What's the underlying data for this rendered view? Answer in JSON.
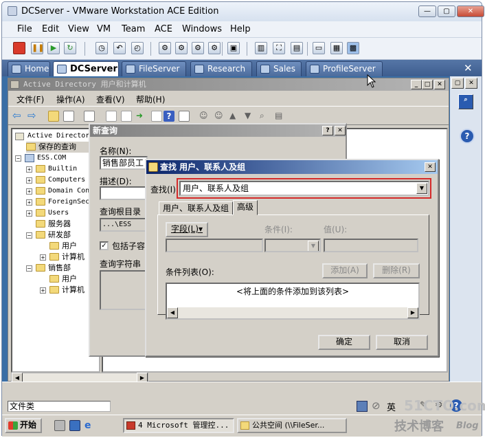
{
  "vmware": {
    "title": "DCServer - VMware Workstation ACE Edition",
    "menu": [
      "File",
      "Edit",
      "View",
      "VM",
      "Team",
      "ACE",
      "Windows",
      "Help"
    ],
    "tabs": [
      {
        "label": "Home"
      },
      {
        "label": "DCServer",
        "active": true
      },
      {
        "label": "FileServer"
      },
      {
        "label": "Research"
      },
      {
        "label": "Sales"
      },
      {
        "label": "ProfileServer"
      }
    ],
    "close_tab": "✕"
  },
  "mmc": {
    "title": "Active Directory 用户和计算机",
    "menu": [
      "文件(F)",
      "操作(A)",
      "查看(V)",
      "帮助(H)"
    ],
    "tree": {
      "root": "Active Directory",
      "saved_queries": "保存的查询",
      "domain": "ESS.COM",
      "children": [
        "Builtin",
        "Computers",
        "Domain Con",
        "ForeignSec",
        "Users"
      ],
      "ous": [
        {
          "label": "服务器"
        },
        {
          "label": "研发部",
          "children": [
            "用户",
            "计算机"
          ]
        },
        {
          "label": "销售部",
          "children": [
            "用户",
            "计算机"
          ]
        }
      ]
    }
  },
  "new_query": {
    "title": "新查询",
    "name_label": "名称(N):",
    "name_value": "销售部员工",
    "desc_label": "描述(D):",
    "root_label": "查询根目录",
    "root_value": "...\\ESS",
    "include_sub_label": "包括子容",
    "include_sub_checked": true,
    "query_string_label": "查询字符串"
  },
  "find_dialog": {
    "title": "查找 用户、联系人及组",
    "find_label": "查找(I):",
    "find_value": "用户、联系人及组",
    "tabs": [
      "用户、联系人及组",
      "高级"
    ],
    "active_tab": "高级",
    "field_button": "字段(L)",
    "condition_label": "条件(I):",
    "value_label": "值(U):",
    "add_button": "添加(A)",
    "remove_button": "删除(R)",
    "condition_list_label": "条件列表(O):",
    "condition_list_placeholder": "<将上面的条件添加到该列表>",
    "ok_button": "确定",
    "cancel_button": "取消"
  },
  "guest_taskbar": {
    "start": "开始",
    "tasks": [
      "4 Microsoft 管理控...",
      "公共空间 (\\\\FileSer..."
    ],
    "status_left": "文件类",
    "ime_label": "英"
  },
  "watermark": {
    "site": "51CTO.com",
    "blog": "技术博客",
    "blog_suffix": "Blog"
  },
  "colors": {
    "vm_chrome": "#dfe7f2",
    "tabbar": "#4d6c9c",
    "active_title": "#0a246a",
    "inactive_title": "#808080",
    "highlight_box": "#d42a2a",
    "dialog_face": "#d4d0c8"
  }
}
